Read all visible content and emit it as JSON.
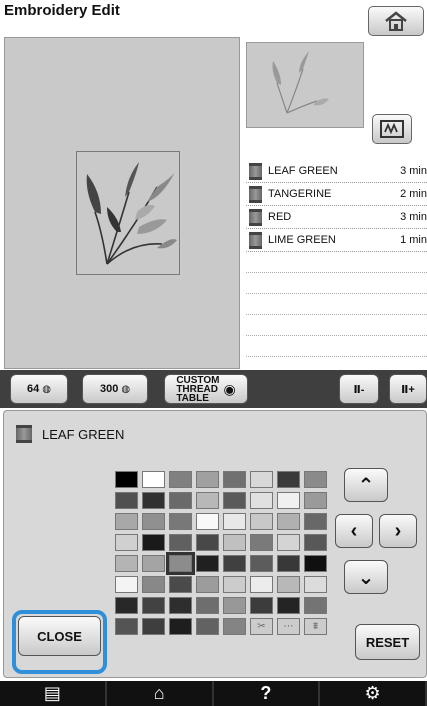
{
  "window": {
    "title": "Embroidery Edit"
  },
  "threads": [
    {
      "name": "LEAF GREEN",
      "time": "3 min"
    },
    {
      "name": "TANGERINE",
      "time": "2 min"
    },
    {
      "name": "RED",
      "time": "3 min"
    },
    {
      "name": "LIME GREEN",
      "time": "1 min"
    }
  ],
  "toolbar": {
    "palette64_label": "64",
    "palette300_label": "300",
    "custom_line1": "CUSTOM",
    "custom_line2": "THREAD",
    "custom_line3": "TABLE",
    "minus_label": "Ⅱ-",
    "plus_label": "Ⅱ+"
  },
  "selected_thread": {
    "name": "LEAF GREEN"
  },
  "palette": {
    "swatches": [
      "#000000",
      "#ffffff",
      "#808080",
      "#a0a0a0",
      "#707070",
      "#d8d8d8",
      "#3a3a3a",
      "#8a8a8a",
      "#505050",
      "#303030",
      "#6a6a6a",
      "#b8b8b8",
      "#5a5a5a",
      "#e0e0e0",
      "#f0f0f0",
      "#9a9a9a",
      "#a8a8a8",
      "#909090",
      "#787878",
      "#f8f8f8",
      "#e8e8e8",
      "#c8c8c8",
      "#b0b0b0",
      "#686868",
      "#d0d0d0",
      "#1a1a1a",
      "#606060",
      "#484848",
      "#c0c0c0",
      "#7a7a7a",
      "#d4d4d4",
      "#585858",
      "#b4b4b4",
      "#a4a4a4",
      "#8c8c8c",
      "#202020",
      "#404040",
      "#5c5c5c",
      "#383838",
      "#101010",
      "#f4f4f4",
      "#888888",
      "#4a4a4a",
      "#9c9c9c",
      "#cccccc",
      "#ececec",
      "#b8b8b8",
      "#dcdcdc",
      "#282828",
      "#424242",
      "#2e2e2e",
      "#6e6e6e",
      "#989898",
      "#3c3c3c",
      "#242424",
      "#747474",
      "#545454",
      "#3e3e3e",
      "#1e1e1e",
      "#626262",
      "#848484",
      "icon",
      "icon",
      "icon"
    ],
    "selected_index": 34
  },
  "buttons": {
    "close_label": "CLOSE",
    "reset_label": "RESET"
  },
  "bottom": {
    "help_label": "?"
  }
}
